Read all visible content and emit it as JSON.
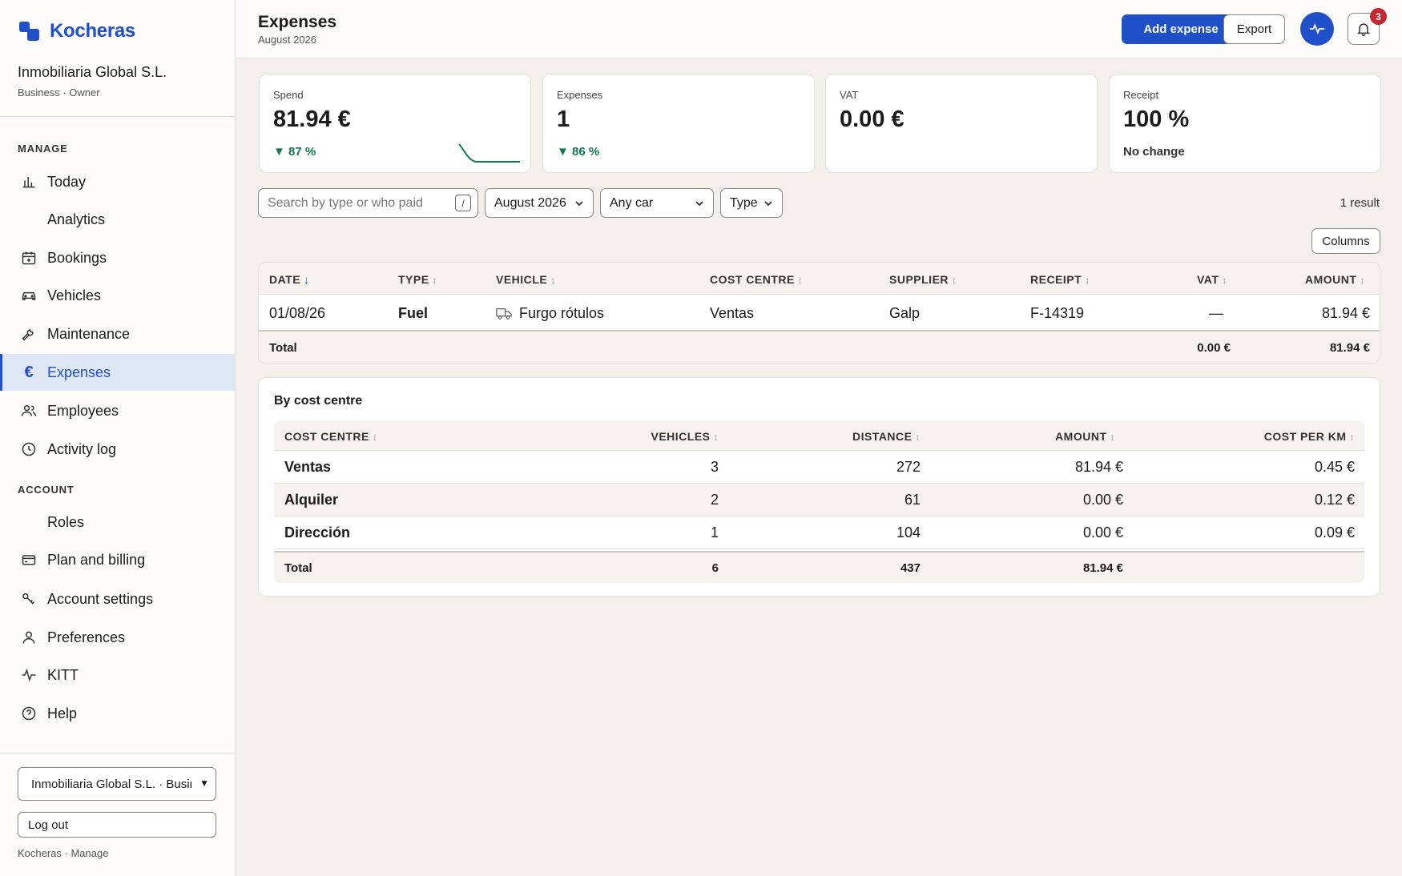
{
  "brand": {
    "name": "Kocheras"
  },
  "org": {
    "name": "Inmobiliaria Global S.L.",
    "role": "Business · Owner"
  },
  "sidebar": {
    "manage_label": "MANAGE",
    "account_label": "ACCOUNT",
    "manage_items": [
      {
        "label": "Today",
        "icon": "bar-chart-icon"
      },
      {
        "label": "Analytics",
        "icon": ""
      },
      {
        "label": "Bookings",
        "icon": "calendar-icon"
      },
      {
        "label": "Vehicles",
        "icon": "car-icon"
      },
      {
        "label": "Maintenance",
        "icon": "wrench-icon"
      },
      {
        "label": "Expenses",
        "icon": "euro-icon"
      },
      {
        "label": "Employees",
        "icon": "users-icon"
      },
      {
        "label": "Activity log",
        "icon": "clock-icon"
      }
    ],
    "account_items": [
      {
        "label": "Roles",
        "icon": ""
      },
      {
        "label": "Plan and billing",
        "icon": "credit-card-icon"
      },
      {
        "label": "Account settings",
        "icon": "key-icon"
      },
      {
        "label": "Preferences",
        "icon": "user-icon"
      },
      {
        "label": "KITT",
        "icon": "pulse-icon"
      },
      {
        "label": "Help",
        "icon": "help-circle-icon"
      }
    ],
    "org_select": "Inmobiliaria Global S.L. · Business",
    "logout_label": "Log out",
    "footer": "Kocheras · Manage"
  },
  "header": {
    "title": "Expenses",
    "subtitle": "August 2026",
    "add_label": "Add expense",
    "export_label": "Export",
    "notification_count": "3"
  },
  "kpis": [
    {
      "label": "Spend",
      "value": "81.94 €",
      "delta": "▼ 87 %"
    },
    {
      "label": "Expenses",
      "value": "1",
      "delta": "▼ 86 %"
    },
    {
      "label": "VAT",
      "value": "0.00 €",
      "delta": ""
    },
    {
      "label": "Receipt",
      "value": "100 %",
      "delta": "No change"
    }
  ],
  "filters": {
    "search_placeholder": "Search by type or who paid",
    "search_shortcut": "/",
    "period": "August 2026",
    "car": "Any car",
    "type": "Type",
    "result_count": "1 result",
    "columns_label": "Columns"
  },
  "expenses_table": {
    "headers": [
      "DATE",
      "TYPE",
      "VEHICLE",
      "COST CENTRE",
      "SUPPLIER",
      "RECEIPT",
      "VAT",
      "AMOUNT"
    ],
    "sort_active": "↓",
    "sort_idle": "↕",
    "rows": [
      {
        "date": "01/08/26",
        "type": "Fuel",
        "vehicle": "Furgo rótulos",
        "cost_centre": "Ventas",
        "supplier": "Galp",
        "receipt": "F-14319",
        "vat": "—",
        "amount": "81.94 €"
      }
    ],
    "total_label": "Total",
    "total_vat": "0.00 €",
    "total_amount": "81.94 €"
  },
  "cost_centre": {
    "title": "By cost centre",
    "headers": [
      "COST CENTRE",
      "VEHICLES",
      "DISTANCE",
      "AMOUNT",
      "COST PER KM"
    ],
    "rows": [
      {
        "name": "Ventas",
        "vehicles": "3",
        "distance": "272",
        "amount": "81.94 €",
        "cost_per_km": "0.45 €"
      },
      {
        "name": "Alquiler",
        "vehicles": "2",
        "distance": "61",
        "amount": "0.00 €",
        "cost_per_km": "0.12 €"
      },
      {
        "name": "Dirección",
        "vehicles": "1",
        "distance": "104",
        "amount": "0.00 €",
        "cost_per_km": "0.09 €"
      }
    ],
    "total_label": "Total",
    "total_vehicles": "6",
    "total_distance": "437",
    "total_amount": "81.94 €"
  },
  "colors": {
    "accent": "#1f4fc9",
    "positive": "#0e7a4a",
    "badge": "#c8262e"
  }
}
